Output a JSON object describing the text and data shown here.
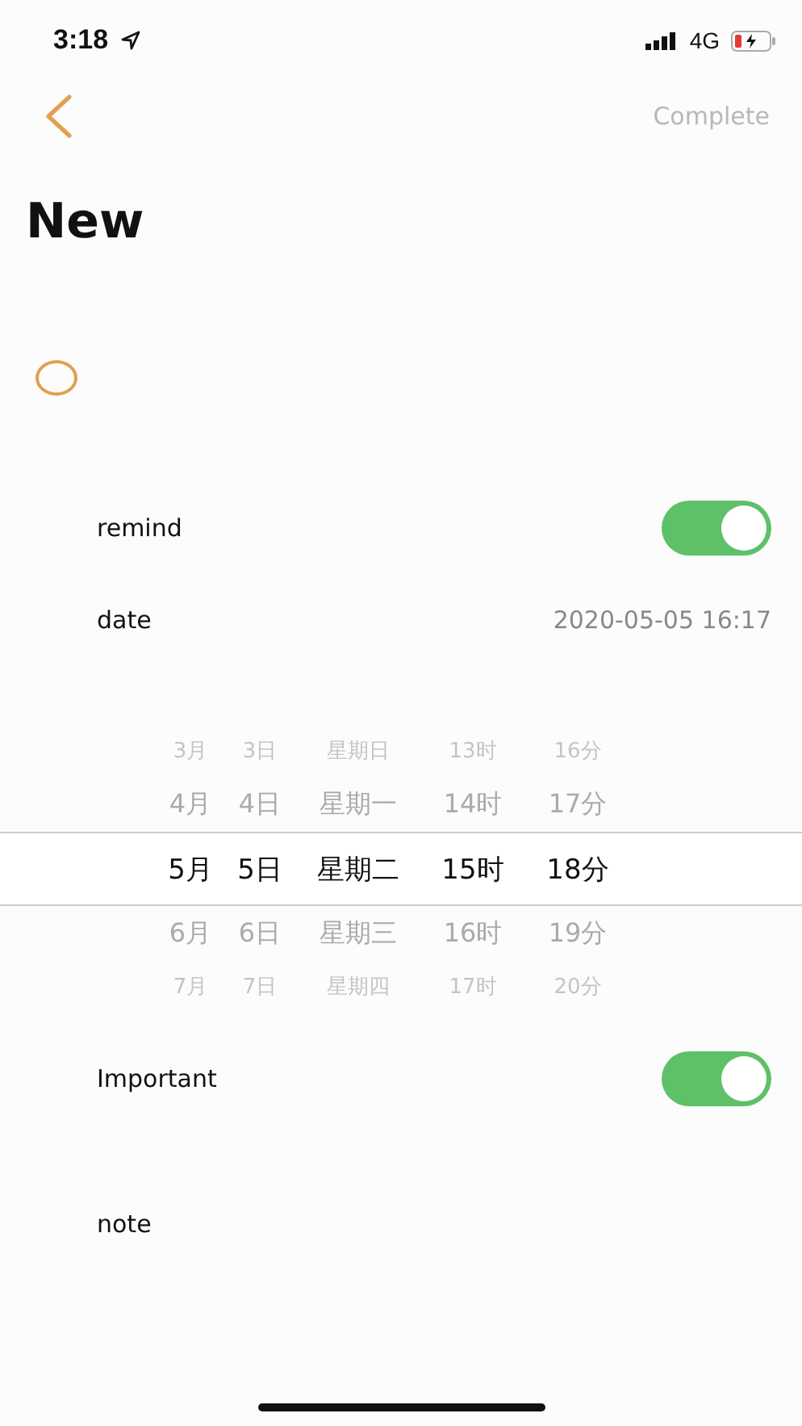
{
  "status_bar": {
    "time": "3:18",
    "network": "4G"
  },
  "nav": {
    "complete": "Complete"
  },
  "title": "New",
  "task": {
    "checked": false
  },
  "remind": {
    "label": "remind",
    "on": true
  },
  "date": {
    "label": "date",
    "value": "2020-05-05 16:17"
  },
  "picker": {
    "rows": [
      {
        "cells": [
          "3月",
          "3日",
          "星期日",
          "13时",
          "16分"
        ],
        "selected": false
      },
      {
        "cells": [
          "4月",
          "4日",
          "星期一",
          "14时",
          "17分"
        ],
        "selected": false
      },
      {
        "cells": [
          "5月",
          "5日",
          "星期二",
          "15时",
          "18分"
        ],
        "selected": true
      },
      {
        "cells": [
          "6月",
          "6日",
          "星期三",
          "16时",
          "19分"
        ],
        "selected": false
      },
      {
        "cells": [
          "7月",
          "7日",
          "星期四",
          "17时",
          "20分"
        ],
        "selected": false
      }
    ]
  },
  "important": {
    "label": "Important",
    "on": true
  },
  "note": {
    "label": "note"
  }
}
